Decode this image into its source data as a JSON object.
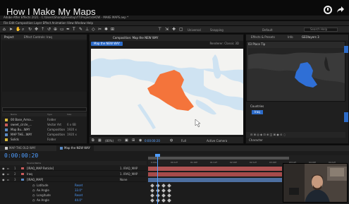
{
  "video": {
    "title": "How I Make My Maps"
  },
  "app": {
    "window_title": "Adobe After Effects 2021 - C:\\Users\\Shariq\\Desktop\\YT\\Projects\\HOW - MAKE MAPS.aep *",
    "menu": "File  Edit  Composition  Layer  Effect  Animation  View  Window  Help"
  },
  "toolbar": {
    "universal": "Universal",
    "snapping": "Snapping",
    "workspace_default": "Default",
    "search_placeholder": "Search Help"
  },
  "project_panel": {
    "tab_project": "Project",
    "tab_effect_controls": "Effect Controls: Iraq",
    "columns": [
      "Name",
      "Type",
      "Size"
    ],
    "items": [
      {
        "name": "00 Base_Arma...",
        "type": "Folder",
        "size": "",
        "color": "#d9b93a"
      },
      {
        "name": "sweet_circle_...",
        "type": "Vector Art",
        "size": "6 x 6B",
        "color": "#c95b5b"
      },
      {
        "name": "Map Bu...WAY",
        "type": "Composition",
        "size": "1920 x",
        "color": "#5a8ac4"
      },
      {
        "name": "MAP THE...WAY",
        "type": "Composition",
        "size": "1920 x",
        "color": "#5a8ac4"
      },
      {
        "name": "Solids",
        "type": "Folder",
        "size": "",
        "color": "#d9b93a"
      }
    ]
  },
  "composition_panel": {
    "tab_label": "Composition: Map the NEW WAY",
    "sub_tab": "Map the NEW WAY",
    "renderer": "Renderer: Classic 3D",
    "zoom": "(80%)",
    "timecode": "0:00:00:20",
    "resolution": "Full",
    "camera": "Active Camera"
  },
  "right_panel": {
    "tabs": [
      "Effects & Presets",
      "Info",
      "GEOlayers 3"
    ],
    "preview_tab": "03 Place Tip",
    "countries_label": "Countries",
    "selected_country": "Iraq",
    "character_label": "Character"
  },
  "timeline": {
    "tabs": [
      {
        "label": "MAP THE OLD WAY",
        "color": "#c8c8c8",
        "active": false
      },
      {
        "label": "Map the NEW WAY",
        "color": "#5a8ac4",
        "active": true
      }
    ],
    "timecode": "0:00:00:20",
    "columns": "Source Name",
    "ruler_ticks": [
      "0:00s",
      "00:12f",
      "01:00f",
      "01:12f",
      "02:00f",
      "02:12f",
      "03:00f",
      "03:12f",
      "04:00f",
      "04:12f"
    ],
    "layers": [
      {
        "num": "1",
        "name": "[IRAQ_MAP Reticle]",
        "parent": "1. IRAQ_MAP",
        "color": "#c95b5b",
        "track_color": "#b05454"
      },
      {
        "num": "2",
        "name": "Iraq",
        "parent": "1. IRAQ_MAP",
        "color": "#c95b5b",
        "track_color": "#a64b4b"
      },
      {
        "num": "3",
        "name": "[IRAQ_MAP]",
        "parent": "None",
        "color": "#5a8ac4",
        "track_color": "#4d6fa0"
      }
    ],
    "sub_rows": [
      {
        "label": "Latitude",
        "value": "Reset"
      },
      {
        "label": "Ae Angle",
        "value": "33.0°"
      },
      {
        "label": "Longitude",
        "value": "Reset"
      },
      {
        "label": "Ae Angle",
        "value": "44.0°"
      }
    ]
  },
  "colors": {
    "highlight_country": "#f4743b",
    "preview_country": "#2f6fd6",
    "accent_blue": "#2d6cc9"
  }
}
